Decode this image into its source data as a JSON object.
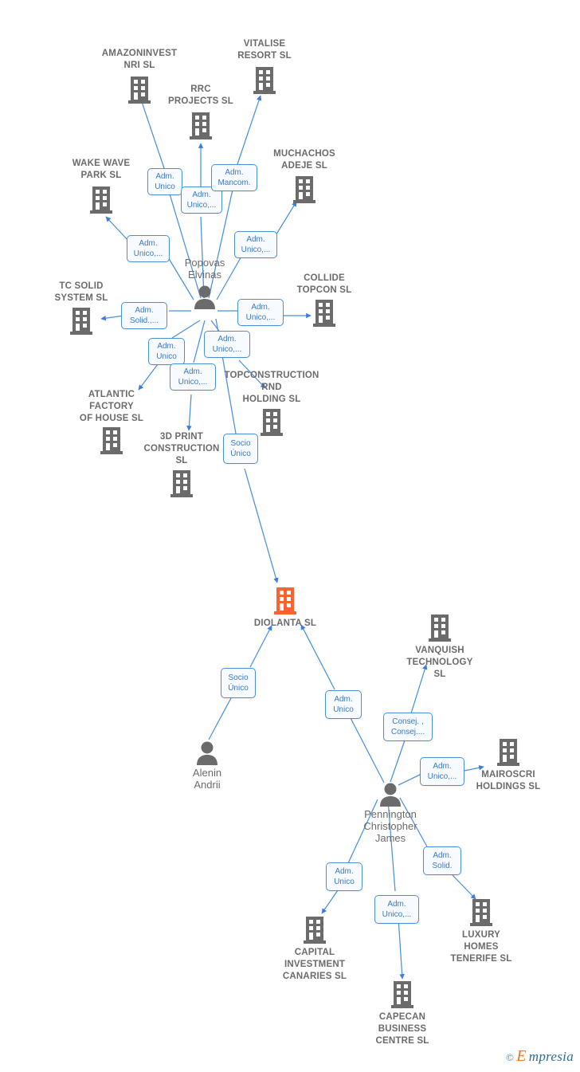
{
  "diagram": {
    "title": "DIOLANTA SL corporate relationship network",
    "colors": {
      "focus_entity": "#fa6432",
      "entity_gray": "#6b6b6b",
      "edge_blue": "#4a90d9",
      "label_border": "#4a90d9",
      "label_text": "#3b78c3",
      "label_fill": "#f7fbff",
      "watermark_orange": "#ef7622",
      "watermark_blue": "#2e6b8e"
    },
    "watermark": {
      "copyright": "©",
      "brand_initial": "E",
      "brand_rest": "mpresia"
    }
  },
  "nodes": [
    {
      "id": "amazoninvest",
      "kind": "company",
      "label": "AMAZONINVEST\nNRI  SL",
      "focus": false
    },
    {
      "id": "vitalise",
      "kind": "company",
      "label": "VITALISE\nRESORT  SL",
      "focus": false
    },
    {
      "id": "rrc",
      "kind": "company",
      "label": "RRC\nPROJECTS  SL",
      "focus": false
    },
    {
      "id": "wakewave",
      "kind": "company",
      "label": "WAKE WAVE\nPARK  SL",
      "focus": false
    },
    {
      "id": "muchachos",
      "kind": "company",
      "label": "MUCHACHOS\nADEJE  SL",
      "focus": false
    },
    {
      "id": "tcsolid",
      "kind": "company",
      "label": "TC SOLID\nSYSTEM  SL",
      "focus": false
    },
    {
      "id": "collide",
      "kind": "company",
      "label": "COLLIDE\nTOPCON  SL",
      "focus": false
    },
    {
      "id": "atlantic",
      "kind": "company",
      "label": "ATLANTIC\nFACTORY\nOF HOUSE  SL",
      "focus": false
    },
    {
      "id": "3dprint",
      "kind": "company",
      "label": "3D PRINT\nCONSTRUCTION\nSL",
      "focus": false
    },
    {
      "id": "topconstruction",
      "kind": "company",
      "label": "TOPCONSTRUCTION\nRND\nHOLDING  SL",
      "focus": false
    },
    {
      "id": "diolanta",
      "kind": "company",
      "label": "DIOLANTA  SL",
      "focus": true
    },
    {
      "id": "vanquish",
      "kind": "company",
      "label": "VANQUISH\nTECHNOLOGY\nSL",
      "focus": false
    },
    {
      "id": "mairoscri",
      "kind": "company",
      "label": "MAIROSCRI\nHOLDINGS  SL",
      "focus": false
    },
    {
      "id": "capital",
      "kind": "company",
      "label": "CAPITAL\nINVESTMENT\nCANARIES  SL",
      "focus": false
    },
    {
      "id": "capecan",
      "kind": "company",
      "label": "CAPECAN\nBUSINESS\nCENTRE SL",
      "focus": false
    },
    {
      "id": "luxury",
      "kind": "company",
      "label": "LUXURY\nHOMES\nTENERIFE  SL",
      "focus": false
    },
    {
      "id": "popovas",
      "kind": "person",
      "label": "Popovas\nElvinas",
      "focus": false
    },
    {
      "id": "alenin",
      "kind": "person",
      "label": "Alenin\nAndrii",
      "focus": false
    },
    {
      "id": "pennington",
      "kind": "person",
      "label": "Pennington\nChristopher\nJames",
      "focus": false
    }
  ],
  "relation_labels": [
    {
      "id": "r1",
      "text": "Adm.\nUnico",
      "from": "popovas",
      "to": "amazoninvest"
    },
    {
      "id": "r2",
      "text": "Adm.\nUnico,...",
      "from": "popovas",
      "to": "rrc"
    },
    {
      "id": "r3",
      "text": "Adm.\nMancom.",
      "from": "popovas",
      "to": "vitalise"
    },
    {
      "id": "r4",
      "text": "Adm.\nUnico,...",
      "from": "popovas",
      "to": "wakewave"
    },
    {
      "id": "r5",
      "text": "Adm.\nUnico,...",
      "from": "popovas",
      "to": "muchachos"
    },
    {
      "id": "r6",
      "text": "Adm.\nSolid.,...",
      "from": "popovas",
      "to": "tcsolid"
    },
    {
      "id": "r7",
      "text": "Adm.\nUnico,...",
      "from": "popovas",
      "to": "collide"
    },
    {
      "id": "r8",
      "text": "Adm.\nUnico",
      "from": "popovas",
      "to": "atlantic"
    },
    {
      "id": "r9",
      "text": "Adm.\nUnico,...",
      "from": "popovas",
      "to": "3dprint"
    },
    {
      "id": "r10",
      "text": "Adm.\nUnico,...",
      "from": "popovas",
      "to": "topconstruction"
    },
    {
      "id": "r11",
      "text": "Socio\nÚnico",
      "from": "popovas",
      "to": "diolanta"
    },
    {
      "id": "r12",
      "text": "Socio\nÚnico",
      "from": "alenin",
      "to": "diolanta"
    },
    {
      "id": "r13",
      "text": "Adm.\nUnico",
      "from": "pennington",
      "to": "diolanta"
    },
    {
      "id": "r14",
      "text": "Consej. ,\nConsej....",
      "from": "pennington",
      "to": "vanquish"
    },
    {
      "id": "r15",
      "text": "Adm.\nUnico,...",
      "from": "pennington",
      "to": "mairoscri"
    },
    {
      "id": "r16",
      "text": "Adm.\nUnico",
      "from": "pennington",
      "to": "capital"
    },
    {
      "id": "r17",
      "text": "Adm.\nUnico,...",
      "from": "pennington",
      "to": "capecan"
    },
    {
      "id": "r18",
      "text": "Adm.\nSolid.",
      "from": "pennington",
      "to": "luxury"
    }
  ]
}
